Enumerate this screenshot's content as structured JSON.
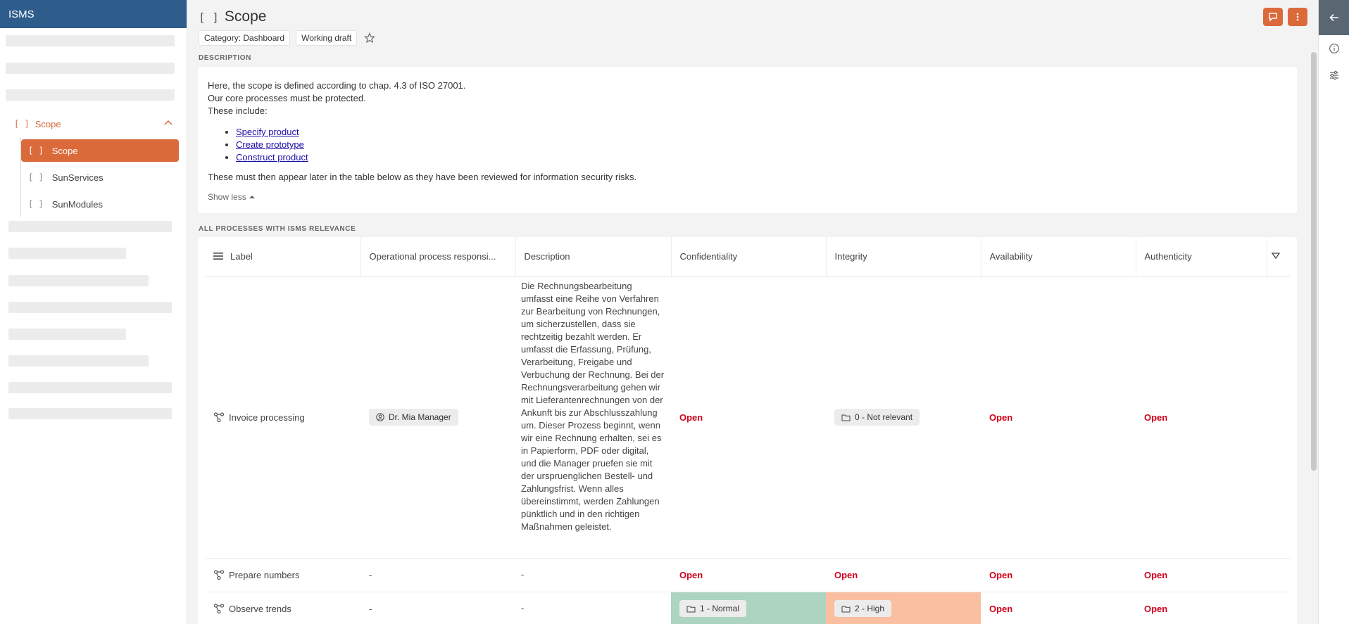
{
  "app": {
    "name": "ISMS"
  },
  "sidebar": {
    "group": {
      "label": "Scope"
    },
    "items": [
      {
        "label": "Scope",
        "active": true
      },
      {
        "label": "SunServices",
        "active": false
      },
      {
        "label": "SunModules",
        "active": false
      }
    ]
  },
  "page": {
    "title": "Scope",
    "category_chip": "Category: Dashboard",
    "status_chip": "Working draft"
  },
  "description": {
    "section_label": "DESCRIPTION",
    "line1": "Here, the scope is defined according to chap. 4.3 of ISO 27001.",
    "line2": "Our core processes must be protected.",
    "line3": "These include:",
    "links": [
      "Specify product",
      "Create prototype",
      "Construct product"
    ],
    "line4": "These must then appear later in the table below as they have been reviewed for information security risks.",
    "show_less": "Show less"
  },
  "table": {
    "section_label": "ALL PROCESSES WITH ISMS RELEVANCE",
    "columns": [
      "Label",
      "Operational process responsi...",
      "Description",
      "Confidentiality",
      "Integrity",
      "Availability",
      "Authenticity"
    ],
    "rows": [
      {
        "label": "Invoice processing",
        "responsible": "Dr. Mia Manager",
        "description": "Die Rechnungsbearbeitung umfasst eine Reihe von Verfahren zur Bearbeitung von Rechnungen, um sicherzustellen, dass sie rechtzeitig bezahlt werden. Er umfasst die Erfassung, Prüfung, Verarbeitung, Freigabe und Verbuchung der Rechnung. Bei der Rechnungsverarbeitung gehen wir mit Lieferantenrechnungen von der Ankunft bis zur Abschlusszahlung um. Dieser Prozess beginnt, wenn wir eine Rechnung erhalten, sei es in Papierform, PDF oder digital, und die Manager pruefen sie mit der urspruenglichen Bestell- und Zahlungsfrist. Wenn alles übereinstimmt, werden Zahlungen pünktlich und in den richtigen Maßnahmen geleistet.",
        "confidentiality": "Open",
        "integrity": "0 - Not relevant",
        "availability": "Open",
        "authenticity": "Open"
      },
      {
        "label": "Prepare numbers",
        "responsible": "-",
        "description": "-",
        "confidentiality": "Open",
        "integrity": "Open",
        "availability": "Open",
        "authenticity": "Open"
      },
      {
        "label": "Observe trends",
        "responsible": "-",
        "description": "-",
        "confidentiality": "1 - Normal",
        "integrity": "2 - High",
        "availability": "Open",
        "authenticity": "Open"
      }
    ]
  },
  "colors": {
    "accent": "#db6a3b",
    "header": "#2e5d8c",
    "open_red": "#d0021b",
    "normal_green": "#acd4c0",
    "high_orange": "#f9bfa0"
  }
}
